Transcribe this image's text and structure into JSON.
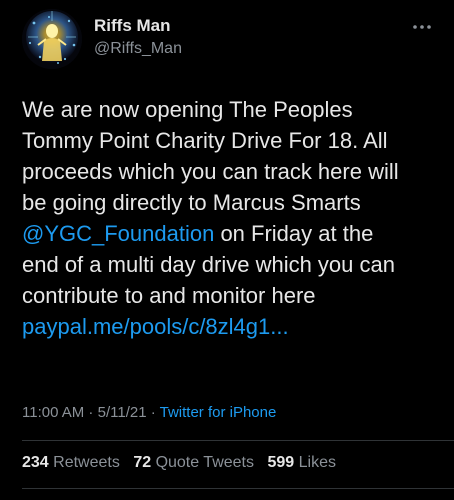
{
  "author": {
    "name": "Riffs Man",
    "handle": "@Riffs_Man",
    "avatar_icon": "avatar-image-icon"
  },
  "menu": {
    "more_icon": "more-horizontal-icon"
  },
  "tweet": {
    "line1": "We are now opening The Peoples",
    "line2": "Tommy Point Charity Drive For 18. All",
    "line3": "proceeds which you can track here will",
    "line4": "be going directly to Marcus Smarts",
    "mention": "@YGC_Foundation",
    "line5_rest": " on Friday at the",
    "line6": "end of a multi day drive which you can",
    "line7": "contribute to and monitor here",
    "link": "paypal.me/pools/c/8zl4g1..."
  },
  "meta": {
    "time": "11:00 AM",
    "separator1": " · ",
    "date": "5/11/21",
    "separator2": " · ",
    "source": "Twitter for iPhone"
  },
  "stats": {
    "retweets_count": "234",
    "retweets_label": "Retweets",
    "quotes_count": "72",
    "quotes_label": "Quote Tweets",
    "likes_count": "599",
    "likes_label": "Likes"
  },
  "colors": {
    "background": "#000000",
    "link": "#1d9bf0",
    "secondary_text": "#8b9198",
    "primary_text": "#e7e7e7"
  }
}
